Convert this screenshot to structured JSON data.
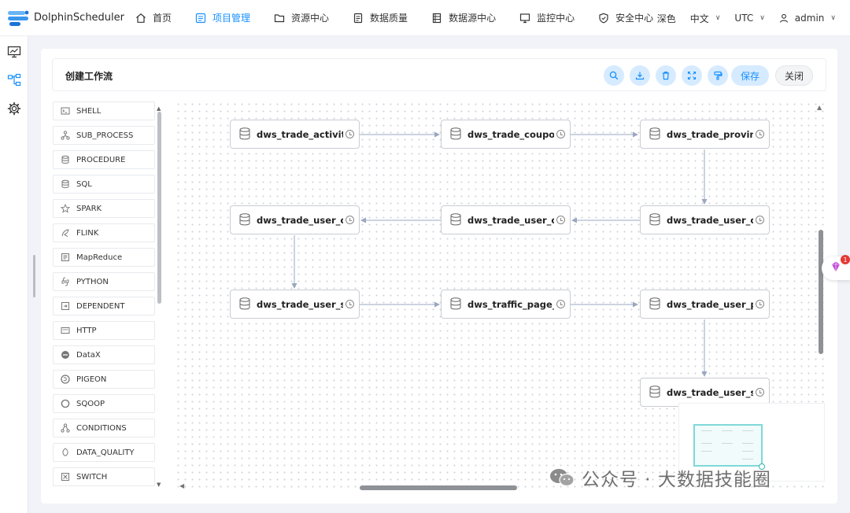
{
  "app": {
    "name": "DolphinScheduler"
  },
  "nav": [
    {
      "label": "首页",
      "icon": "home-icon"
    },
    {
      "label": "项目管理",
      "icon": "project-icon",
      "active": true
    },
    {
      "label": "资源中心",
      "icon": "folder-icon"
    },
    {
      "label": "数据质量",
      "icon": "quality-icon"
    },
    {
      "label": "数据源中心",
      "icon": "datasource-icon"
    },
    {
      "label": "监控中心",
      "icon": "monitor-icon"
    },
    {
      "label": "安全中心",
      "icon": "shield-icon"
    }
  ],
  "top_right": {
    "theme": "深色",
    "language": "中文",
    "timezone": "UTC",
    "user": "admin"
  },
  "page": {
    "title": "创建工作流",
    "save_label": "保存",
    "close_label": "关闭"
  },
  "toolbar_icons": [
    "search-icon",
    "download-icon",
    "delete-icon",
    "fullscreen-icon",
    "format-icon"
  ],
  "palette": [
    {
      "label": "SHELL",
      "icon": "shell-icon"
    },
    {
      "label": "SUB_PROCESS",
      "icon": "sub-process-icon"
    },
    {
      "label": "PROCEDURE",
      "icon": "procedure-icon"
    },
    {
      "label": "SQL",
      "icon": "sql-icon"
    },
    {
      "label": "SPARK",
      "icon": "spark-icon"
    },
    {
      "label": "FLINK",
      "icon": "flink-icon"
    },
    {
      "label": "MapReduce",
      "icon": "mapreduce-icon"
    },
    {
      "label": "PYTHON",
      "icon": "python-icon"
    },
    {
      "label": "DEPENDENT",
      "icon": "dependent-icon"
    },
    {
      "label": "HTTP",
      "icon": "http-icon"
    },
    {
      "label": "DataX",
      "icon": "datax-icon"
    },
    {
      "label": "PIGEON",
      "icon": "pigeon-icon"
    },
    {
      "label": "SQOOP",
      "icon": "sqoop-icon"
    },
    {
      "label": "CONDITIONS",
      "icon": "conditions-icon"
    },
    {
      "label": "DATA_QUALITY",
      "icon": "data-quality-icon"
    },
    {
      "label": "SWITCH",
      "icon": "switch-icon"
    }
  ],
  "nodes": [
    {
      "label": "dws_trade_activity..."
    },
    {
      "label": "dws_trade_coupon_..."
    },
    {
      "label": "dws_trade_province"
    },
    {
      "label": "dws_trade_user_car."
    },
    {
      "label": "dws_trade_user_ord"
    },
    {
      "label": "dws_trade_user_ord"
    },
    {
      "label": "dws_trade_user_sku"
    },
    {
      "label": "dws_traffic_page_v.."
    },
    {
      "label": "dws_trade_user_pay"
    },
    {
      "label": "dws_trade_user_sku"
    }
  ],
  "notification": {
    "count": "1"
  },
  "watermark": {
    "text": "公众号 · 大数据技能圈"
  }
}
